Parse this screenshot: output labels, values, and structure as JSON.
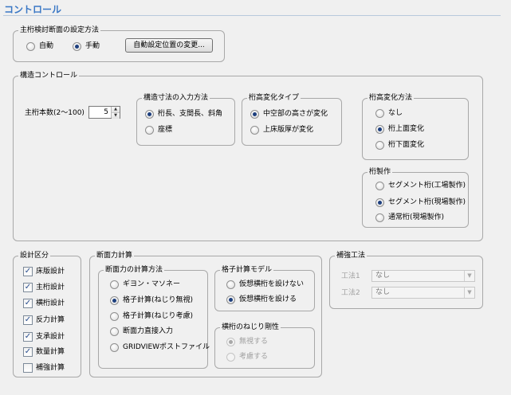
{
  "header": {
    "title": "コントロール"
  },
  "girder_section": {
    "title": "主桁検討断面の設定方法",
    "options": [
      {
        "label": "自動",
        "selected": false
      },
      {
        "label": "手動",
        "selected": true
      }
    ],
    "change_button": "自動設定位置の変更..."
  },
  "structure": {
    "title": "構造コントロール",
    "girder_count_label": "主桁本数(2〜100)",
    "girder_count_value": "5",
    "dimension_input": {
      "title": "構造寸法の入力方法",
      "options": [
        {
          "label": "桁長、支間長、斜角",
          "selected": true
        },
        {
          "label": "座標",
          "selected": false
        }
      ]
    },
    "girder_height_type": {
      "title": "桁高変化タイプ",
      "options": [
        {
          "label": "中空部の高さが変化",
          "selected": true
        },
        {
          "label": "上床版厚が変化",
          "selected": false
        }
      ]
    },
    "height_change_method": {
      "title": "桁高変化方法",
      "options": [
        {
          "label": "なし",
          "selected": false
        },
        {
          "label": "桁上面変化",
          "selected": true
        },
        {
          "label": "桁下面変化",
          "selected": false
        }
      ]
    },
    "girder_fabrication": {
      "title": "桁製作",
      "options": [
        {
          "label": "セグメント桁(工場製作)",
          "selected": false
        },
        {
          "label": "セグメント桁(現場製作)",
          "selected": true
        },
        {
          "label": "通常桁(現場製作)",
          "selected": false
        }
      ]
    }
  },
  "design": {
    "title": "設計区分",
    "items": [
      {
        "label": "床版設計",
        "checked": true
      },
      {
        "label": "主桁設計",
        "checked": true
      },
      {
        "label": "横桁設計",
        "checked": true
      },
      {
        "label": "反力計算",
        "checked": true
      },
      {
        "label": "支承設計",
        "checked": true
      },
      {
        "label": "数量計算",
        "checked": true
      },
      {
        "label": "補強計算",
        "checked": false
      }
    ]
  },
  "section_force": {
    "title": "断面力計算",
    "method": {
      "title": "断面力の計算方法",
      "options": [
        {
          "label": "ギヨン・マソネー",
          "selected": false
        },
        {
          "label": "格子計算(ねじり無視)",
          "selected": true
        },
        {
          "label": "格子計算(ねじり考慮)",
          "selected": false
        },
        {
          "label": "断面力直接入力",
          "selected": false
        },
        {
          "label": "GRIDVIEWポストファイル",
          "selected": false
        }
      ]
    },
    "grid_model": {
      "title": "格子計算モデル",
      "options": [
        {
          "label": "仮想横桁を設けない",
          "selected": false
        },
        {
          "label": "仮想横桁を設ける",
          "selected": true
        }
      ]
    },
    "torsion": {
      "title": "横桁のねじり剛性",
      "options": [
        {
          "label": "無視する",
          "selected": true
        },
        {
          "label": "考慮する",
          "selected": false
        }
      ]
    }
  },
  "reinforcement": {
    "title": "補強工法",
    "rows": [
      {
        "label": "工法1",
        "value": "なし"
      },
      {
        "label": "工法2",
        "value": "なし"
      }
    ]
  }
}
